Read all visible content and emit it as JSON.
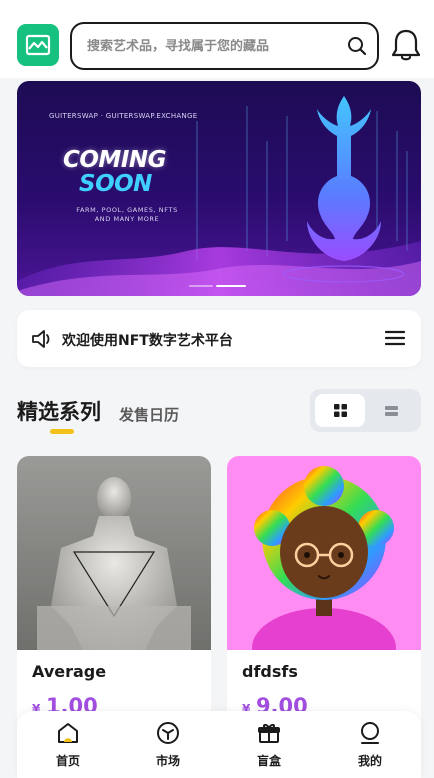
{
  "header": {
    "search_placeholder": "搜索艺术品，寻找属于您的藏品"
  },
  "banner": {
    "caption": "GUITERSWAP · GUITERSWAP.EXCHANGE",
    "headline_1": "COMING",
    "headline_2": "SOON",
    "desc_line_1": "FARM, POOL, GAMES, NFTS",
    "desc_line_2": "AND MANY MORE",
    "slide_count": 2,
    "active_slide": 1
  },
  "notice": {
    "text": "欢迎使用NFT数字艺术平台"
  },
  "section": {
    "title": "精选系列",
    "subtitle": "发售日历"
  },
  "cards": [
    {
      "name": "Average",
      "currency": "¥",
      "price": "1.00"
    },
    {
      "name": "dfdsfs",
      "currency": "¥",
      "price": "9.00"
    }
  ],
  "tabbar": {
    "items": [
      {
        "label": "首页",
        "icon": "home-icon"
      },
      {
        "label": "市场",
        "icon": "cube-icon"
      },
      {
        "label": "盲盒",
        "icon": "gift-icon"
      },
      {
        "label": "我的",
        "icon": "user-icon"
      }
    ]
  },
  "colors": {
    "brand": "#16c07f",
    "price": "#a24ee0",
    "accent": "#f3c21a"
  }
}
